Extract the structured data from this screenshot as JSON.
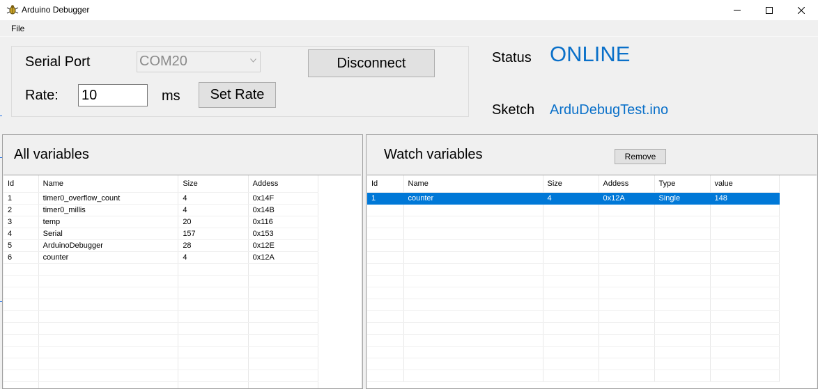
{
  "window": {
    "title": "Arduino Debugger"
  },
  "menu": {
    "file": "File"
  },
  "connection": {
    "serial_port_label": "Serial Port",
    "port_value": "COM20",
    "disconnect_label": "Disconnect",
    "rate_label": "Rate:",
    "rate_value": "10",
    "ms_label": "ms",
    "set_rate_label": "Set Rate"
  },
  "status": {
    "label": "Status",
    "value": "ONLINE",
    "sketch_label": "Sketch",
    "sketch_value": "ArduDebugTest.ino"
  },
  "colors": {
    "accent": "#0a70c9",
    "selection": "#0078d7"
  },
  "all_variables": {
    "title": "All variables",
    "columns": [
      "Id",
      "Name",
      "Size",
      "Addess"
    ],
    "rows": [
      [
        "1",
        "timer0_overflow_count",
        "4",
        "0x14F"
      ],
      [
        "2",
        "timer0_millis",
        "4",
        "0x14B"
      ],
      [
        "3",
        "temp",
        "20",
        "0x116"
      ],
      [
        "4",
        "Serial",
        "157",
        "0x153"
      ],
      [
        "5",
        "ArduinoDebugger",
        "28",
        "0x12E"
      ],
      [
        "6",
        "counter",
        "4",
        "0x12A"
      ]
    ]
  },
  "watch_variables": {
    "title": "Watch variables",
    "remove_label": "Remove",
    "columns": [
      "Id",
      "Name",
      "Size",
      "Addess",
      "Type",
      "value"
    ],
    "rows": [
      [
        "1",
        "counter",
        "4",
        "0x12A",
        "Single",
        "148"
      ]
    ],
    "selected_row": 0
  }
}
